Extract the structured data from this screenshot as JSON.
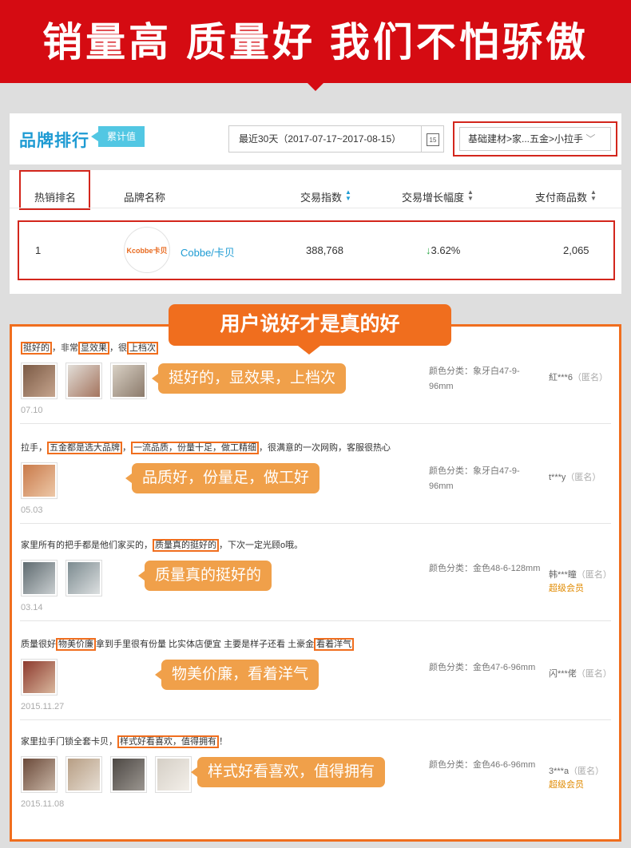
{
  "banner": {
    "title": "销量高 质量好  我们不怕骄傲"
  },
  "ranking": {
    "title": "品牌排行",
    "badge": "累计值",
    "date_range": "最近30天（2017-07-17~2017-08-15）",
    "calendar_day": "15",
    "category": "基础建材>家...五金>小拉手",
    "columns": {
      "rank": "热销排名",
      "brand": "品牌名称",
      "index": "交易指数",
      "growth": "交易增长幅度",
      "items": "支付商品数"
    },
    "row": {
      "rank": "1",
      "logo_text": "Kcobbe卡贝",
      "brand": "Cobbe/卡贝",
      "index": "388,768",
      "growth": "3.62%",
      "growth_arrow": "↓",
      "items": "2,065"
    }
  },
  "reviews_tab": "用户说好才是真的好",
  "reviews": [
    {
      "parts": [
        {
          "t": "挺好的",
          "h": true
        },
        {
          "t": "，非常",
          "h": false
        },
        {
          "t": "显效果",
          "h": true
        },
        {
          "t": "，很",
          "h": false
        },
        {
          "t": "上档次",
          "h": true
        }
      ],
      "date": "07.10",
      "spec": "颜色分类：象牙白47-9-96mm",
      "user": "紅***6",
      "anon": "（匿名）",
      "member": "",
      "bubble": "挺好的，显效果，上档次"
    },
    {
      "parts": [
        {
          "t": "拉手，",
          "h": false
        },
        {
          "t": "五金都是选大品牌",
          "h": true
        },
        {
          "t": "，",
          "h": false
        },
        {
          "t": "一流品质，份量十足，做工精细",
          "h": true
        },
        {
          "t": "，很满意的一次网购，客服很热心",
          "h": false
        }
      ],
      "date": "05.03",
      "spec": "颜色分类：象牙白47-9-96mm",
      "user": "t***y",
      "anon": "（匿名）",
      "member": "",
      "bubble": "品质好，份量足，做工好"
    },
    {
      "parts": [
        {
          "t": "家里所有的把手都是他们家买的，",
          "h": false
        },
        {
          "t": "质量真的挺好的",
          "h": true
        },
        {
          "t": "，下次一定光顾o哦。",
          "h": false
        }
      ],
      "date": "03.14",
      "spec": "颜色分类：金色48-6-128mm",
      "user": "韩***瞳",
      "anon": "（匿名）",
      "member": "超级会员",
      "bubble": "质量真的挺好的"
    },
    {
      "parts": [
        {
          "t": "质量很好",
          "h": false
        },
        {
          "t": "物美价廉",
          "h": true
        },
        {
          "t": "拿到手里很有份量 比实体店便宜 主要是样子还看 土豪金",
          "h": false
        },
        {
          "t": "看着洋气",
          "h": true
        }
      ],
      "date": "2015.11.27",
      "spec": "颜色分类：金色47-6-96mm",
      "user": "闪***佬",
      "anon": "（匿名）",
      "member": "",
      "bubble": "物美价廉，看着洋气"
    },
    {
      "parts": [
        {
          "t": "家里拉手门锁全套卡贝，",
          "h": false
        },
        {
          "t": "样式好看喜欢，值得拥有",
          "h": true
        },
        {
          "t": "！",
          "h": false
        }
      ],
      "date": "2015.11.08",
      "spec": "颜色分类：金色46-6-96mm",
      "user": "3***a",
      "anon": "（匿名）",
      "member": "超级会员",
      "bubble": "样式好看喜欢，值得拥有"
    }
  ],
  "colors": {
    "banner": "#d50b12",
    "accent_orange": "#f06e1e",
    "bubble": "#f0a04a",
    "brand_blue": "#1e9bd3",
    "highlight_red": "#d3261c"
  }
}
